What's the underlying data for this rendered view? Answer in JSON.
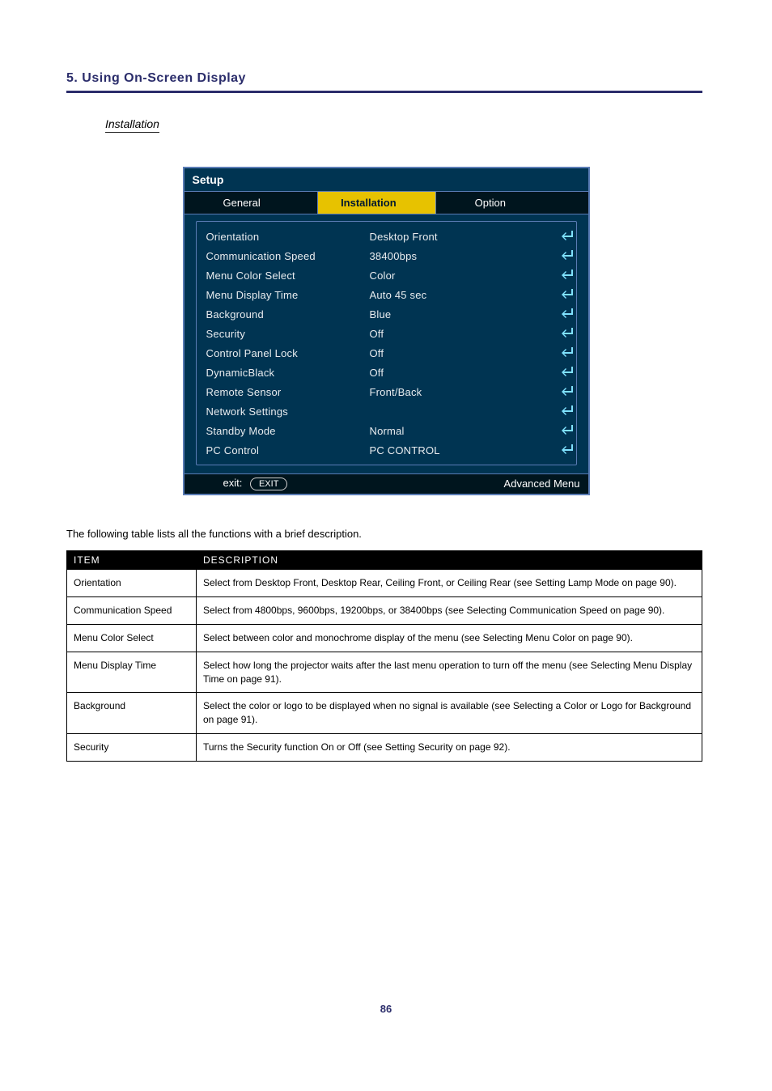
{
  "section": {
    "heading": "5. Using On-Screen Display",
    "subheading": "Installation"
  },
  "osd": {
    "panel_title": "Setup",
    "tabs": [
      {
        "label": "General",
        "active": false
      },
      {
        "label": "Installation",
        "active": true
      },
      {
        "label": "Option",
        "active": false
      }
    ],
    "rows": [
      {
        "label": "Orientation",
        "value": "Desktop Front"
      },
      {
        "label": "Communication Speed",
        "value": "38400bps"
      },
      {
        "label": "Menu Color Select",
        "value": "Color"
      },
      {
        "label": "Menu Display Time",
        "value": "Auto 45 sec"
      },
      {
        "label": "Background",
        "value": "Blue"
      },
      {
        "label": "Security",
        "value": "Off"
      },
      {
        "label": "Control Panel Lock",
        "value": "Off"
      },
      {
        "label": "DynamicBlack",
        "value": "Off"
      },
      {
        "label": "Remote Sensor",
        "value": "Front/Back"
      },
      {
        "label": "Network Settings",
        "value": ""
      },
      {
        "label": "Standby Mode",
        "value": "Normal"
      },
      {
        "label": "PC Control",
        "value": "PC CONTROL"
      }
    ],
    "footer": {
      "exit_label": "exit:",
      "exit_button": "EXIT",
      "right_label": "Advanced Menu"
    }
  },
  "doc": {
    "paragraph": "The following table lists all the functions with a brief description.",
    "table": {
      "headers": [
        "ITEM",
        "DESCRIPTION"
      ],
      "rows": [
        {
          "item": "Orientation",
          "desc": "Select from Desktop Front, Desktop Rear, Ceiling Front, or Ceiling Rear (see Setting Lamp Mode on page 90)."
        },
        {
          "item": "Communication Speed",
          "desc": "Select from 4800bps, 9600bps, 19200bps, or 38400bps (see Selecting Communication Speed on page 90)."
        },
        {
          "item": "Menu Color Select",
          "desc": "Select between color and monochrome display of the menu (see Selecting Menu Color on page 90)."
        },
        {
          "item": "Menu Display Time",
          "desc": "Select how long the projector waits after the last menu operation to turn off the menu (see Selecting Menu Display Time on page 91)."
        },
        {
          "item": "Background",
          "desc": "Select the color or logo to be displayed when no signal is available (see Selecting a Color or Logo for Background on page 91)."
        },
        {
          "item": "Security",
          "desc": "Turns the Security function On or Off (see Setting Security on page 92)."
        }
      ]
    },
    "page_number": "86"
  }
}
